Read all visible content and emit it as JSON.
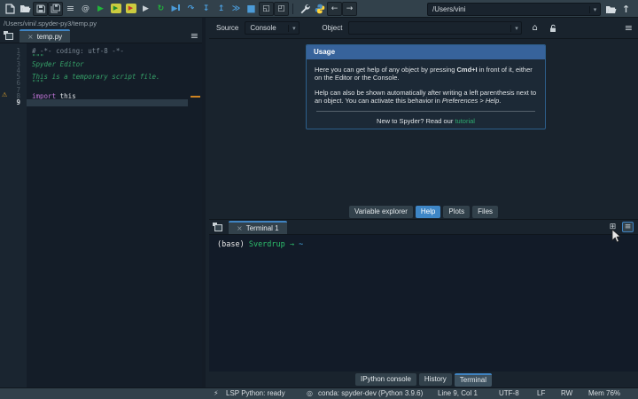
{
  "toolbar": {
    "path_combo": "/Users/vini"
  },
  "icons": {
    "menu": "≡",
    "at": "@",
    "run": "▶",
    "rerun": "↻",
    "debug": "▶",
    "step_over": "↷",
    "step_into": "↧",
    "step_out": "↥",
    "continue": "≫",
    "stop": "■",
    "maximize": "◱",
    "fullscreen": "◰",
    "back": "←",
    "forward": "→",
    "up": "↑",
    "home": "⌂",
    "close": "×",
    "add": "⊞",
    "warning": "⚠",
    "dropdown": "▾",
    "lsp": "⚡",
    "conda": "◎",
    "cell_run": "▶",
    "cell_adv": "▶",
    "run_selection": "▶"
  },
  "editor": {
    "filepath": "/Users/vini/.spyder-py3/temp.py",
    "tab": "temp.py",
    "lines": [
      {
        "num": "1",
        "text": "# -*- coding: utf-8 -*-"
      },
      {
        "num": "2",
        "text": "\"\"\""
      },
      {
        "num": "3",
        "text": "Spyder Editor"
      },
      {
        "num": "4",
        "text": ""
      },
      {
        "num": "5",
        "text": "This is a temporary script file."
      },
      {
        "num": "6",
        "text": "\"\"\""
      },
      {
        "num": "7",
        "text": ""
      },
      {
        "num": "8",
        "kw": "import",
        "rest": " this"
      },
      {
        "num": "9",
        "text": ""
      }
    ]
  },
  "help": {
    "source_label": "Source",
    "console_value": "Console",
    "object_label": "Object",
    "usage": {
      "title": "Usage",
      "p1_a": "Here you can get help of any object by pressing ",
      "p1_b": "Cmd+I",
      "p1_c": " in front of it, either on the Editor or the Console.",
      "p2_a": "Help can also be shown automatically after writing a left parenthesis next to an object. You can activate this behavior in ",
      "p2_b": "Preferences > Help",
      "p2_c": ".",
      "footer_a": "New to Spyder? Read our ",
      "footer_link": "tutorial"
    },
    "tabs": [
      "Variable explorer",
      "Help",
      "Plots",
      "Files"
    ]
  },
  "terminal": {
    "tab": "Terminal 1",
    "prompt_env": "(base) ",
    "prompt_host": "Sverdrup",
    "prompt_arrow": " → ",
    "prompt_path": " ~"
  },
  "bottom_tabs": [
    "IPython console",
    "History",
    "Terminal"
  ],
  "statusbar": {
    "lsp": "LSP Python: ready",
    "conda": "conda: spyder-dev (Python 3.9.6)",
    "cursor": "Line 9, Col 1",
    "encoding": "UTF-8",
    "eol": "LF",
    "permissions": "RW",
    "memory": "Mem 76%"
  },
  "colors": {
    "accent_blue": "#3F83C1",
    "selected_tab_blue": "#3E86C6",
    "run_green": "#21B53A",
    "debug_blue": "#4B9BD8",
    "warning_orange": "#CE8321",
    "string_green": "#36A269",
    "keyword_purple": "#C678DD",
    "link_green": "#2EAC70"
  }
}
